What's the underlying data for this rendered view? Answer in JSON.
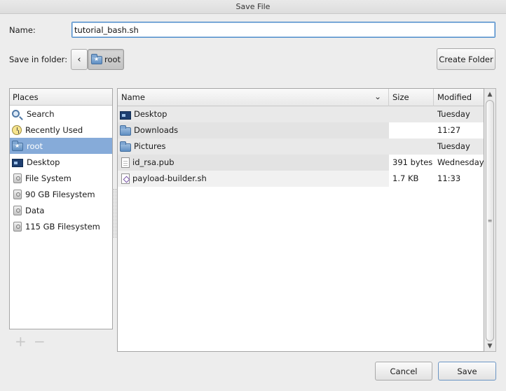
{
  "window": {
    "title": "Save File"
  },
  "name_field": {
    "label": "Name:",
    "value": "tutorial_bash.sh"
  },
  "folder": {
    "label": "Save in folder:",
    "back_glyph": "‹",
    "current": "root",
    "create_folder_label": "Create Folder"
  },
  "places": {
    "header": "Places",
    "items": [
      {
        "label": "Search",
        "icon": "search-icon"
      },
      {
        "label": "Recently Used",
        "icon": "recently-used-icon"
      },
      {
        "label": "root",
        "icon": "home-folder-icon",
        "selected": true
      },
      {
        "label": "Desktop",
        "icon": "desktop-icon"
      },
      {
        "label": "File System",
        "icon": "drive-icon"
      },
      {
        "label": "90 GB Filesystem",
        "icon": "drive-icon"
      },
      {
        "label": "Data",
        "icon": "drive-icon"
      },
      {
        "label": "115 GB Filesystem",
        "icon": "drive-icon"
      }
    ],
    "add_glyph": "+",
    "remove_glyph": "−"
  },
  "files": {
    "columns": {
      "name": "Name",
      "size": "Size",
      "modified": "Modified"
    },
    "sort_glyph": "⌄",
    "rows": [
      {
        "name": "Desktop",
        "size": "",
        "modified": "Tuesday",
        "icon": "desktop-icon"
      },
      {
        "name": "Downloads",
        "size": "",
        "modified": "11:27",
        "icon": "folder-icon"
      },
      {
        "name": "Pictures",
        "size": "",
        "modified": "Tuesday",
        "icon": "folder-icon"
      },
      {
        "name": "id_rsa.pub",
        "size": "391 bytes",
        "modified": "Wednesday",
        "icon": "document-icon"
      },
      {
        "name": "payload-builder.sh",
        "size": "1.7 KB",
        "modified": "11:33",
        "icon": "script-icon"
      }
    ]
  },
  "scrollbar": {
    "up_glyph": "▲",
    "down_glyph": "▼",
    "grip_glyph": "≡"
  },
  "actions": {
    "cancel_label": "Cancel",
    "save_label": "Save"
  }
}
